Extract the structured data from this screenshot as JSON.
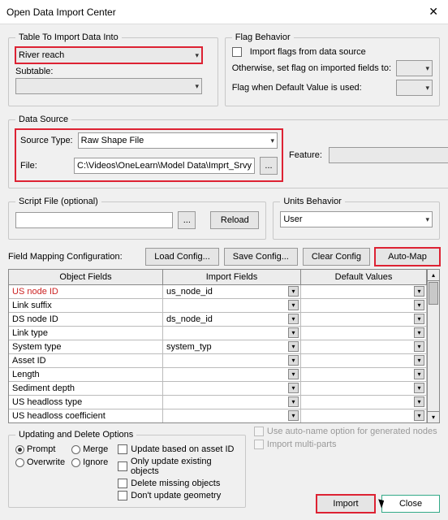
{
  "title": "Open Data Import Center",
  "group_table": "Table To Import Data Into",
  "table_value": "River reach",
  "subtable_label": "Subtable:",
  "group_flag": "Flag Behavior",
  "flag_import": "Import flags from data source",
  "flag_otherwise": "Otherwise, set flag on imported fields to:",
  "flag_default": "Flag when Default Value is used:",
  "group_source": "Data Source",
  "source_type_label": "Source Type:",
  "source_type_value": "Raw Shape File",
  "file_label": "File:",
  "file_value": "C:\\Videos\\OneLearn\\Model Data\\Imprt_Srvy",
  "feature_label": "Feature:",
  "group_script": "Script File (optional)",
  "btn_reload": "Reload",
  "group_units": "Units Behavior",
  "units_value": "User",
  "config_label": "Field Mapping Configuration:",
  "btn_load": "Load Config...",
  "btn_save": "Save Config...",
  "btn_clear": "Clear Config",
  "btn_automap": "Auto-Map",
  "col_object": "Object Fields",
  "col_import": "Import Fields",
  "col_default": "Default Values",
  "rows": [
    {
      "obj": "US node ID",
      "imp": "us_node_id",
      "red": true
    },
    {
      "obj": "Link suffix",
      "imp": ""
    },
    {
      "obj": "DS node ID",
      "imp": "ds_node_id"
    },
    {
      "obj": "Link type",
      "imp": ""
    },
    {
      "obj": "System type",
      "imp": "system_typ"
    },
    {
      "obj": "Asset ID",
      "imp": ""
    },
    {
      "obj": "Length",
      "imp": ""
    },
    {
      "obj": "Sediment depth",
      "imp": ""
    },
    {
      "obj": "US headloss type",
      "imp": ""
    },
    {
      "obj": "US headloss coefficient",
      "imp": ""
    }
  ],
  "group_update": "Updating and Delete Options",
  "opt_prompt": "Prompt",
  "opt_merge": "Merge",
  "opt_overwrite": "Overwrite",
  "opt_ignore": "Ignore",
  "chk_asset": "Update based on asset ID",
  "chk_existing": "Only update existing objects",
  "chk_delete": "Delete missing objects",
  "chk_geom": "Don't update geometry",
  "dim_autoname": "Use auto-name option for generated nodes",
  "dim_multi": "Import multi-parts",
  "btn_import": "Import",
  "btn_close": "Close"
}
